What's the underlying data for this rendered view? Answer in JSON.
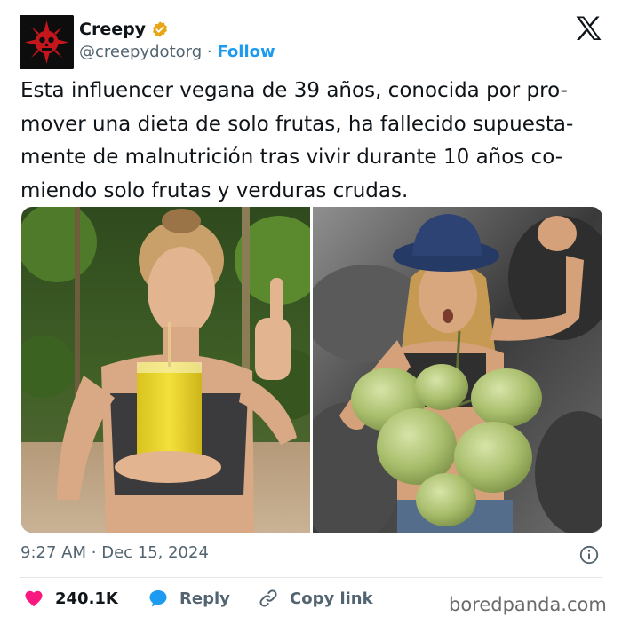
{
  "author": {
    "name": "Creepy",
    "handle": "@creepydotorg",
    "separator": "·",
    "follow_label": "Follow",
    "verified_color": "#e8a617",
    "avatar_colors": {
      "bg": "#0d0d0d",
      "emblem": "#c4161c"
    }
  },
  "tweet": {
    "lines": [
      "Esta influencer vegana de 39 años, conocida por pro-",
      "mover una dieta de solo frutas, ha fallecido supuesta-",
      "mente de malnutrición tras vivir durante 10 años co-",
      "miendo solo frutas y verduras crudas."
    ]
  },
  "meta": {
    "time": "9:27 AM",
    "separator": "·",
    "date": "Dec 15, 2024"
  },
  "actions": {
    "likes": "240.1K",
    "reply_label": "Reply",
    "copy_label": "Copy link"
  },
  "watermark": "boredpanda.com",
  "icons": {
    "x": "x-logo-icon",
    "verified": "verified-badge-icon",
    "info": "info-icon",
    "like": "heart-icon",
    "reply": "speech-bubble-icon",
    "copy": "link-icon"
  },
  "colors": {
    "accent": "#1d9bf0",
    "like": "#f91880",
    "muted": "#536471"
  }
}
